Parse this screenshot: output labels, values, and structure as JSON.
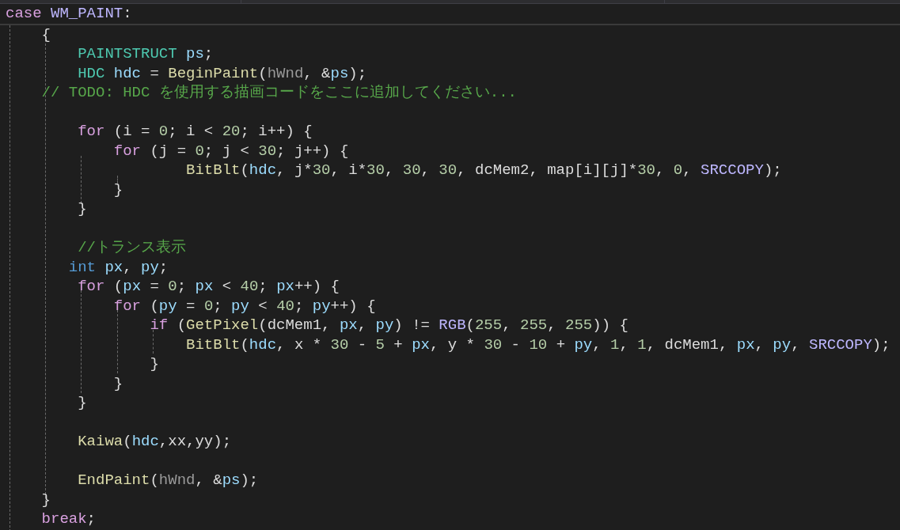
{
  "sticky_line": {
    "tokens": [
      {
        "text": "case ",
        "kind": "ctl"
      },
      {
        "text": "WM_PAINT",
        "kind": "mac"
      },
      {
        "text": ":",
        "kind": "pl"
      }
    ]
  },
  "lines": [
    {
      "tokens": [
        {
          "text": "    {",
          "kind": "pl"
        }
      ]
    },
    {
      "tokens": [
        {
          "text": "        PAINTSTRUCT ",
          "kind": "type"
        },
        {
          "text": "ps",
          "kind": "var"
        },
        {
          "text": ";",
          "kind": "pl"
        }
      ]
    },
    {
      "tokens": [
        {
          "text": "        HDC ",
          "kind": "type"
        },
        {
          "text": "hdc",
          "kind": "var"
        },
        {
          "text": " = ",
          "kind": "pl"
        },
        {
          "text": "BeginPaint",
          "kind": "fn"
        },
        {
          "text": "(",
          "kind": "pl"
        },
        {
          "text": "hWnd",
          "kind": "prm"
        },
        {
          "text": ", &",
          "kind": "pl"
        },
        {
          "text": "ps",
          "kind": "var"
        },
        {
          "text": ");",
          "kind": "pl"
        }
      ]
    },
    {
      "tokens": [
        {
          "text": "    // TODO: HDC を使用する描画コードをここに追加してください...",
          "kind": "cmt"
        }
      ]
    },
    {
      "gap_before": true,
      "tokens": [
        {
          "text": "        for",
          "kind": "ctl"
        },
        {
          "text": " (i = ",
          "kind": "pl"
        },
        {
          "text": "0",
          "kind": "num"
        },
        {
          "text": "; i < ",
          "kind": "pl"
        },
        {
          "text": "20",
          "kind": "num"
        },
        {
          "text": "; i++) {",
          "kind": "pl"
        }
      ]
    },
    {
      "tokens": [
        {
          "text": "            for",
          "kind": "ctl"
        },
        {
          "text": " (j = ",
          "kind": "pl"
        },
        {
          "text": "0",
          "kind": "num"
        },
        {
          "text": "; j < ",
          "kind": "pl"
        },
        {
          "text": "30",
          "kind": "num"
        },
        {
          "text": "; j++) {",
          "kind": "pl"
        }
      ]
    },
    {
      "tokens": [
        {
          "text": "                    BitBlt",
          "kind": "fn"
        },
        {
          "text": "(",
          "kind": "pl"
        },
        {
          "text": "hdc",
          "kind": "var"
        },
        {
          "text": ", j*",
          "kind": "pl"
        },
        {
          "text": "30",
          "kind": "num"
        },
        {
          "text": ", i*",
          "kind": "pl"
        },
        {
          "text": "30",
          "kind": "num"
        },
        {
          "text": ", ",
          "kind": "pl"
        },
        {
          "text": "30",
          "kind": "num"
        },
        {
          "text": ", ",
          "kind": "pl"
        },
        {
          "text": "30",
          "kind": "num"
        },
        {
          "text": ", dcMem2, map[i][j]*",
          "kind": "pl"
        },
        {
          "text": "30",
          "kind": "num"
        },
        {
          "text": ", ",
          "kind": "pl"
        },
        {
          "text": "0",
          "kind": "num"
        },
        {
          "text": ", ",
          "kind": "pl"
        },
        {
          "text": "SRCCOPY",
          "kind": "mac"
        },
        {
          "text": ");",
          "kind": "pl"
        }
      ]
    },
    {
      "tokens": [
        {
          "text": "            }",
          "kind": "pl"
        }
      ]
    },
    {
      "tokens": [
        {
          "text": "        }",
          "kind": "pl"
        }
      ]
    },
    {
      "gap_before": true,
      "tokens": [
        {
          "text": "        //トランス表示",
          "kind": "cmt"
        }
      ]
    },
    {
      "tokens": [
        {
          "text": "       int ",
          "kind": "kwtype"
        },
        {
          "text": "px",
          "kind": "var"
        },
        {
          "text": ", ",
          "kind": "pl"
        },
        {
          "text": "py",
          "kind": "var"
        },
        {
          "text": ";",
          "kind": "pl"
        }
      ]
    },
    {
      "tokens": [
        {
          "text": "        for",
          "kind": "ctl"
        },
        {
          "text": " (",
          "kind": "pl"
        },
        {
          "text": "px",
          "kind": "var"
        },
        {
          "text": " = ",
          "kind": "pl"
        },
        {
          "text": "0",
          "kind": "num"
        },
        {
          "text": "; ",
          "kind": "pl"
        },
        {
          "text": "px",
          "kind": "var"
        },
        {
          "text": " < ",
          "kind": "pl"
        },
        {
          "text": "40",
          "kind": "num"
        },
        {
          "text": "; ",
          "kind": "pl"
        },
        {
          "text": "px",
          "kind": "var"
        },
        {
          "text": "++) {",
          "kind": "pl"
        }
      ]
    },
    {
      "tokens": [
        {
          "text": "            for",
          "kind": "ctl"
        },
        {
          "text": " (",
          "kind": "pl"
        },
        {
          "text": "py",
          "kind": "var"
        },
        {
          "text": " = ",
          "kind": "pl"
        },
        {
          "text": "0",
          "kind": "num"
        },
        {
          "text": "; ",
          "kind": "pl"
        },
        {
          "text": "py",
          "kind": "var"
        },
        {
          "text": " < ",
          "kind": "pl"
        },
        {
          "text": "40",
          "kind": "num"
        },
        {
          "text": "; ",
          "kind": "pl"
        },
        {
          "text": "py",
          "kind": "var"
        },
        {
          "text": "++) {",
          "kind": "pl"
        }
      ]
    },
    {
      "tokens": [
        {
          "text": "                if",
          "kind": "ctl"
        },
        {
          "text": " (",
          "kind": "pl"
        },
        {
          "text": "GetPixel",
          "kind": "fn"
        },
        {
          "text": "(dcMem1, ",
          "kind": "pl"
        },
        {
          "text": "px",
          "kind": "var"
        },
        {
          "text": ", ",
          "kind": "pl"
        },
        {
          "text": "py",
          "kind": "var"
        },
        {
          "text": ") != ",
          "kind": "pl"
        },
        {
          "text": "RGB",
          "kind": "mac"
        },
        {
          "text": "(",
          "kind": "pl"
        },
        {
          "text": "255",
          "kind": "num"
        },
        {
          "text": ", ",
          "kind": "pl"
        },
        {
          "text": "255",
          "kind": "num"
        },
        {
          "text": ", ",
          "kind": "pl"
        },
        {
          "text": "255",
          "kind": "num"
        },
        {
          "text": ")) {",
          "kind": "pl"
        }
      ]
    },
    {
      "tokens": [
        {
          "text": "                    BitBlt",
          "kind": "fn"
        },
        {
          "text": "(",
          "kind": "pl"
        },
        {
          "text": "hdc",
          "kind": "var"
        },
        {
          "text": ", x * ",
          "kind": "pl"
        },
        {
          "text": "30",
          "kind": "num"
        },
        {
          "text": " - ",
          "kind": "pl"
        },
        {
          "text": "5",
          "kind": "num"
        },
        {
          "text": " + ",
          "kind": "pl"
        },
        {
          "text": "px",
          "kind": "var"
        },
        {
          "text": ", y * ",
          "kind": "pl"
        },
        {
          "text": "30",
          "kind": "num"
        },
        {
          "text": " - ",
          "kind": "pl"
        },
        {
          "text": "10",
          "kind": "num"
        },
        {
          "text": " + ",
          "kind": "pl"
        },
        {
          "text": "py",
          "kind": "var"
        },
        {
          "text": ", ",
          "kind": "pl"
        },
        {
          "text": "1",
          "kind": "num"
        },
        {
          "text": ", ",
          "kind": "pl"
        },
        {
          "text": "1",
          "kind": "num"
        },
        {
          "text": ", dcMem1, ",
          "kind": "pl"
        },
        {
          "text": "px",
          "kind": "var"
        },
        {
          "text": ", ",
          "kind": "pl"
        },
        {
          "text": "py",
          "kind": "var"
        },
        {
          "text": ", ",
          "kind": "pl"
        },
        {
          "text": "SRCCOPY",
          "kind": "mac"
        },
        {
          "text": ");",
          "kind": "pl"
        }
      ]
    },
    {
      "tokens": [
        {
          "text": "                }",
          "kind": "pl"
        }
      ]
    },
    {
      "tokens": [
        {
          "text": "            }",
          "kind": "pl"
        }
      ]
    },
    {
      "tokens": [
        {
          "text": "        }",
          "kind": "pl"
        }
      ]
    },
    {
      "gap_before": true,
      "tokens": [
        {
          "text": "        Kaiwa",
          "kind": "fn"
        },
        {
          "text": "(",
          "kind": "pl"
        },
        {
          "text": "hdc",
          "kind": "var"
        },
        {
          "text": ",xx,yy);",
          "kind": "pl"
        }
      ]
    },
    {
      "gap_before": true,
      "tokens": [
        {
          "text": "        EndPaint",
          "kind": "fn"
        },
        {
          "text": "(",
          "kind": "pl"
        },
        {
          "text": "hWnd",
          "kind": "prm"
        },
        {
          "text": ", &",
          "kind": "pl"
        },
        {
          "text": "ps",
          "kind": "var"
        },
        {
          "text": ");",
          "kind": "pl"
        }
      ]
    },
    {
      "tokens": [
        {
          "text": "    }",
          "kind": "pl"
        }
      ]
    },
    {
      "tokens": [
        {
          "text": "    break",
          "kind": "ctl"
        },
        {
          "text": ";",
          "kind": "pl"
        }
      ]
    }
  ]
}
